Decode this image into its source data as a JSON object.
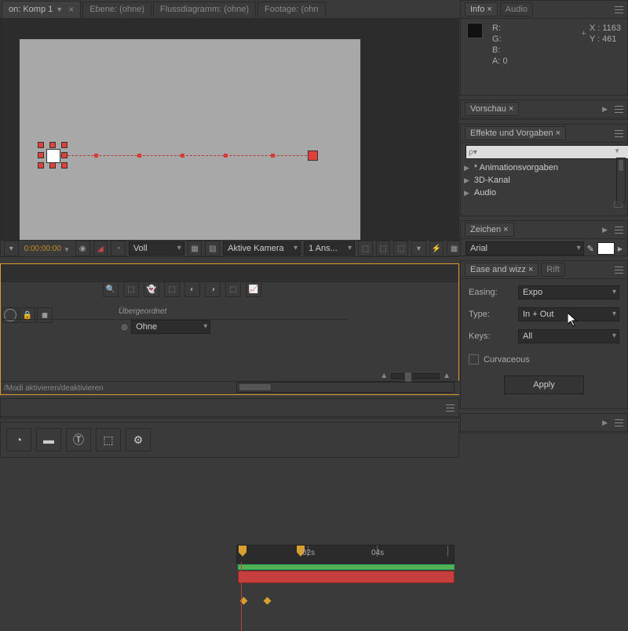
{
  "topTabs": {
    "comp": "on: Komp 1",
    "layer": "Ebene: (ohne)",
    "flow": "Flussdiagramm: (ohne)",
    "footage": "Footage: (ohn"
  },
  "info": {
    "tab1": "Info",
    "tab2": "Audio",
    "r": "R:",
    "g": "G:",
    "b": "B:",
    "a": "A:",
    "a_val": "0",
    "x": "X : 1163",
    "y": "Y : 461"
  },
  "preview": {
    "tab": "Vorschau"
  },
  "effects": {
    "tab": "Effekte und Vorgaben",
    "search": "",
    "item1": "* Animationsvorgaben",
    "item2": "3D-Kanal",
    "item3": "Audio"
  },
  "char": {
    "tab": "Zeichen",
    "font": "Arial"
  },
  "ease": {
    "tab1": "Ease and wizz",
    "tab2": "Rift",
    "easingLabel": "Easing:",
    "easingVal": "Expo",
    "typeLabel": "Type:",
    "typeVal": "In + Out",
    "keysLabel": "Keys:",
    "keysVal": "All",
    "cb": "Curvaceous",
    "apply": "Apply"
  },
  "viewer": {
    "timecode": "0:00:00:00",
    "fitVal": "Voll",
    "activeCam": "Aktive Kamera",
    "views": "1 Ans..."
  },
  "timeline": {
    "parentHead": "Übergeordnet",
    "parentVal": "Ohne",
    "t02": "02s",
    "t04": "04s",
    "statusbar": "/Modi aktivieren/deaktivieren"
  }
}
